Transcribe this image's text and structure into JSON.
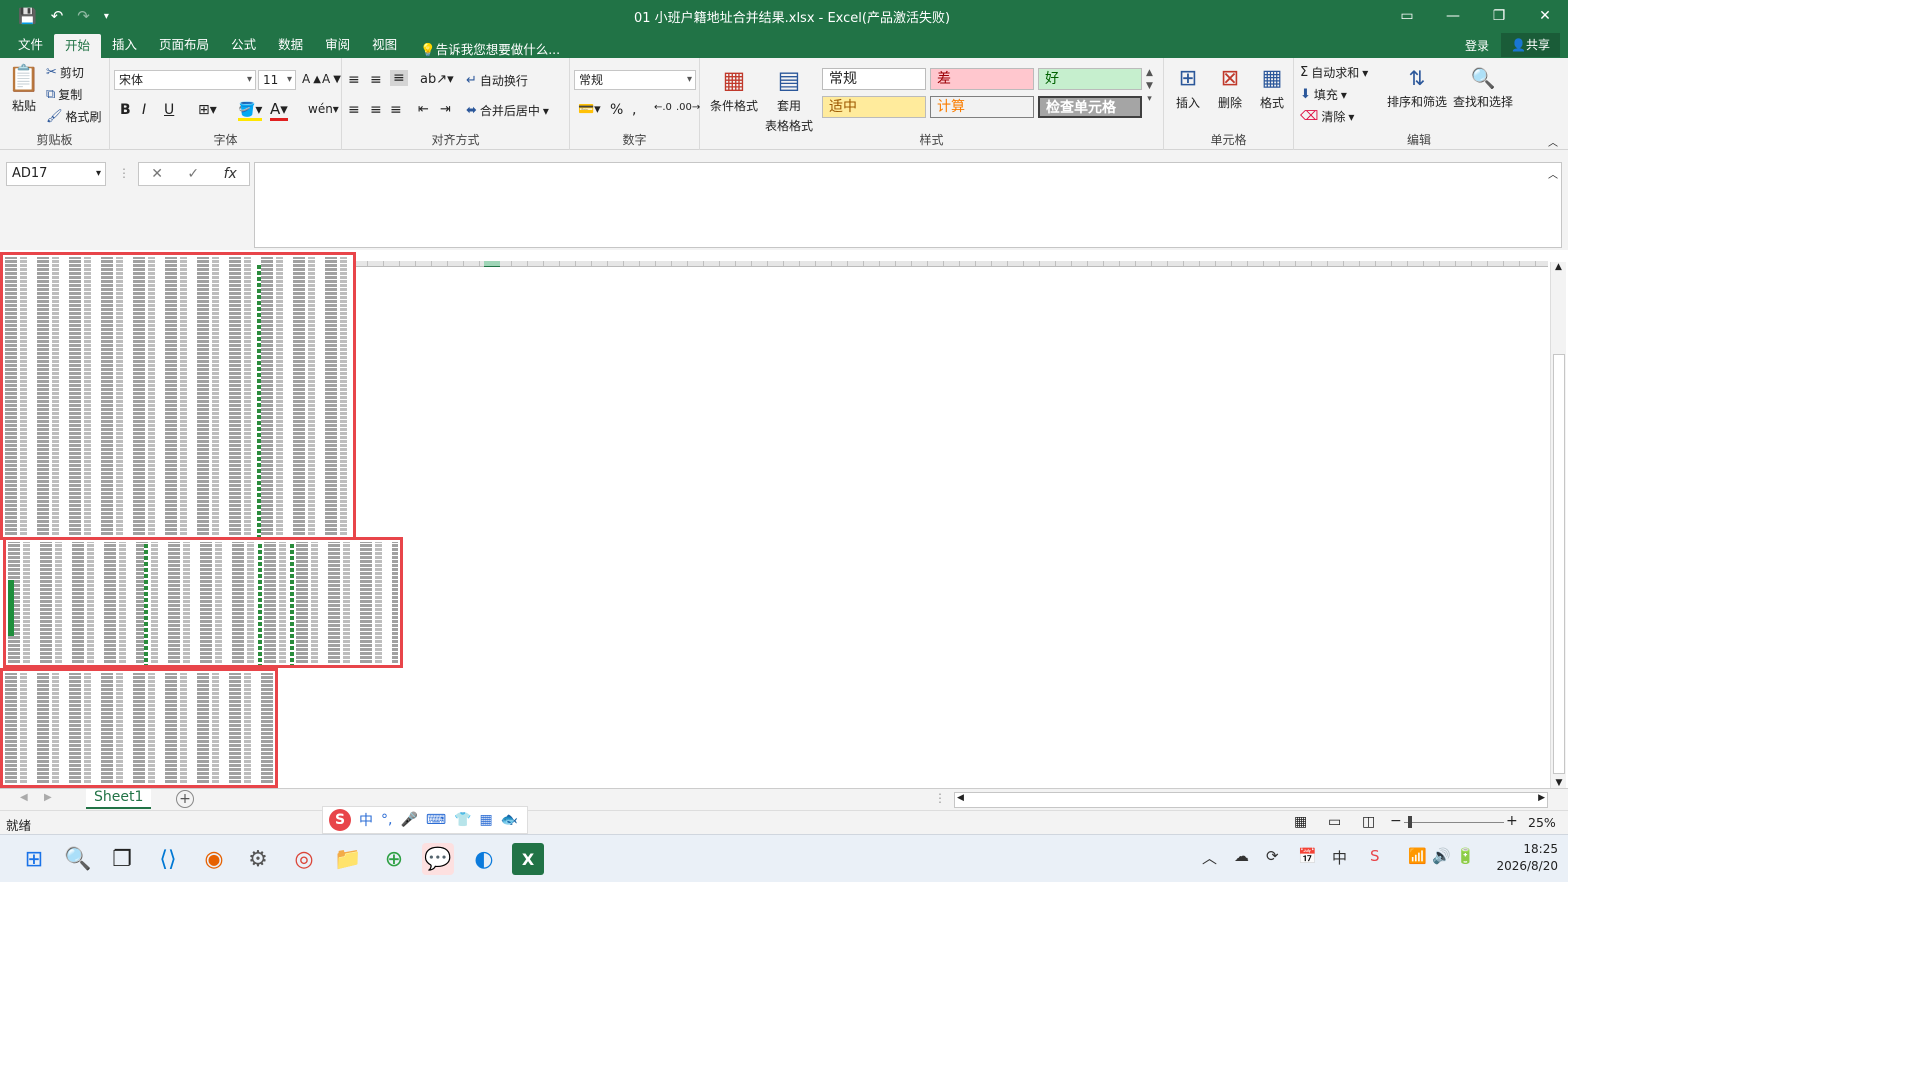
{
  "window": {
    "title": "01 小班户籍地址合并结果.xlsx - Excel(产品激活失败)"
  },
  "menu": {
    "tabs": [
      "文件",
      "开始",
      "插入",
      "页面布局",
      "公式",
      "数据",
      "审阅",
      "视图"
    ],
    "active_tab": "开始",
    "tell_me": "告诉我您想要做什么...",
    "login": "登录",
    "share": "共享"
  },
  "ribbon": {
    "clipboard": {
      "paste": "粘贴",
      "cut": "剪切",
      "copy": "复制",
      "format_painter": "格式刷",
      "label": "剪贴板"
    },
    "font": {
      "name": "宋体",
      "size": "11",
      "label": "字体",
      "bold": "B",
      "italic": "I",
      "underline": "U"
    },
    "alignment": {
      "wrap": "自动换行",
      "merge": "合并后居中",
      "label": "对齐方式"
    },
    "number": {
      "format": "常规",
      "percent": "%",
      "comma": "›",
      "label": "数字"
    },
    "styles": {
      "conditional": "条件格式",
      "table_line1": "套用",
      "table_line2": "表格格式",
      "cells": [
        "常规",
        "差",
        "好",
        "适中",
        "计算",
        "检查单元格"
      ],
      "label": "样式"
    },
    "cells_group": {
      "insert": "插入",
      "delete": "删除",
      "format": "格式",
      "label": "单元格"
    },
    "editing": {
      "autosum": "自动求和",
      "fill": "填充",
      "clear": "清除",
      "sort": "排序和筛选",
      "find": "查找和选择",
      "label": "编辑"
    }
  },
  "formula_bar": {
    "name_box": "AD17",
    "fx": "fx",
    "cancel": "✕",
    "enter": "✓",
    "content": ""
  },
  "sheets": {
    "tabs": [
      "Sheet1"
    ],
    "active": "Sheet1"
  },
  "status": {
    "ready": "就绪",
    "zoom": "25%"
  },
  "ime": {
    "mode": "中"
  },
  "taskbar": {
    "time": "18:25",
    "date": "2026/8/20"
  },
  "colors": {
    "excel_green": "#217346",
    "highlight_red": "#e8454a"
  }
}
